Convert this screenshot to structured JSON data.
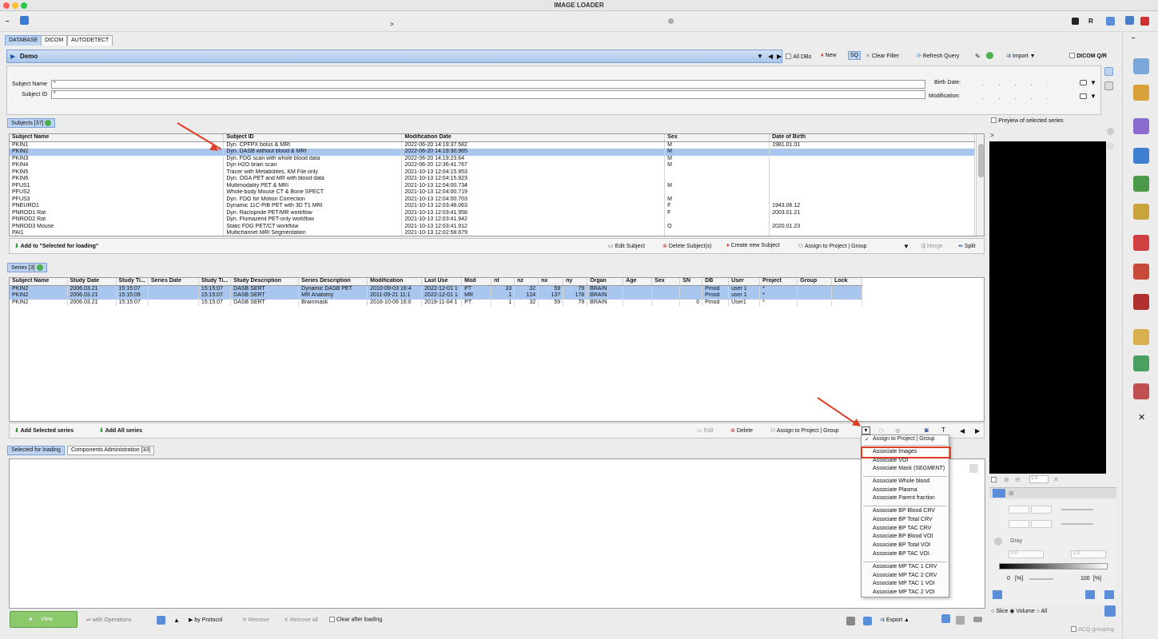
{
  "window": {
    "title": "IMAGE LOADER"
  },
  "toolbar": {
    "chevron": ">",
    "r": "R"
  },
  "tabs": [
    "DATABASE",
    "DICOM",
    "AUTODETECT"
  ],
  "db": {
    "name": "Demo",
    "all_dbs": "All DBs",
    "new": "New",
    "sq": "SQ",
    "clear_filter": "Clear Filter",
    "refresh": "Refresh Query",
    "import": "Import",
    "dicom_qr": "DICOM Q/R"
  },
  "filter": {
    "subject_name_label": "Subject Name",
    "subject_name_value": "*",
    "subject_id_label": "Subject ID",
    "subject_id_value": "*",
    "birth_label": "Birth Date:",
    "mod_label": "Modification:"
  },
  "subjects": {
    "tab": "Subjects [37]",
    "columns": [
      "Subject Name",
      "Subject ID",
      "Modification Date",
      "Sex",
      "Date of Birth"
    ],
    "rows": [
      [
        "PKIN1",
        "Dyn. CPFPX bolus & MRI",
        "2022-06-20 14:19:37.582",
        "M",
        "1981.01.01"
      ],
      [
        "PKIN2",
        "Dyn. DASB without blood & MRI",
        "2022-06-20 14:19:30.965",
        "M",
        ""
      ],
      [
        "PKIN3",
        "Dyn. FDG scan with whole blood data",
        "2022-06-20 14:19:23.64",
        "M",
        ""
      ],
      [
        "PKIN4",
        "Dyn H2O brain scan",
        "2022-06-20 12:36:41.767",
        "M",
        ""
      ],
      [
        "PKIN5",
        "Tracer with Metabolites, KM File only",
        "2021-10-13 12:04:15.953",
        "",
        ""
      ],
      [
        "PKIN6",
        "Dyn. OGA PET and MR with blood data",
        "2021-10-13 12:04:15.923",
        "",
        ""
      ],
      [
        "PFUS1",
        "Multimodality PET & MRI",
        "2021-10-13 12:04:00.734",
        "M",
        ""
      ],
      [
        "PFUS2",
        "Whole-body Mouse CT & Bone SPECT",
        "2021-10-13 12:04:00.719",
        "",
        ""
      ],
      [
        "PFUS3",
        "Dyn. FDG for Motion Correction",
        "2021-10-13 12:04:00.703",
        "M",
        ""
      ],
      [
        "PNEURO1",
        "Dynamic 11C-PiB PET with 3D T1 MRI",
        "2021-10-13 12:03:48.063",
        "F",
        "1943.06.12"
      ],
      [
        "PNROD1 Rat",
        "Dyn. Raclopride PET/MR workflow",
        "2021-10-13 12:03:41.958",
        "F",
        "2003.01.21"
      ],
      [
        "PNROD2 Rat",
        "Dyn. Flumazenil PET-only workflow",
        "2021-10-13 12:03:41.942",
        "",
        ""
      ],
      [
        "PNROD3 Mouse",
        "Static FDG PET/CT workflow",
        "2021-10-13 12:03:41.912",
        "O",
        "2020.01.23"
      ],
      [
        "PAI1",
        "Multichannel MRI Segmentation",
        "2021-10-13 12:02:58.679",
        "",
        ""
      ]
    ],
    "add_btn": "Add to \"Selected for loading\"",
    "edit": "Edit Subject",
    "delete": "Delete Subject(s)",
    "create": "Create new Subject",
    "assign": "Assign to Project | Group",
    "merge": "Merge",
    "split": "Split"
  },
  "series": {
    "tab": "Series [3]",
    "columns": [
      "Subject Name",
      "Study Date",
      "Study Ti...",
      "Series Date",
      "Study Ti...",
      "Study Description",
      "Series Description",
      "Modification",
      "Last Use",
      "Mod",
      "nt",
      "nz",
      "nx",
      "ny",
      "Organ",
      "Age",
      "Sex",
      "SN",
      "DB",
      "User",
      "Project",
      "Group",
      "Lock"
    ],
    "rows": [
      [
        "PKIN2",
        "2006.03.21",
        "15:15:07",
        "",
        "15:15:07",
        "DASB SERT",
        "Dynamic DASB PET",
        "2010-09-03 16:4",
        "2022-12-01 1",
        "PT",
        "33",
        "32",
        "59",
        "79",
        "BRAIN",
        "",
        "",
        "",
        "Pmod",
        "user 1",
        "*",
        "",
        ""
      ],
      [
        "PKIN2",
        "2006.03.21",
        "15:15:09",
        "",
        "15:15:07",
        "DASB SERT",
        "MR Anatomy",
        "2011-09-21 11:1",
        "2022-12-01 1",
        "MR",
        "1",
        "124",
        "137",
        "178",
        "BRAIN",
        "",
        "",
        "",
        "Pmod",
        "user 1",
        "*",
        "",
        ""
      ],
      [
        "PKIN2",
        "2006.03.21",
        "15:15:07",
        "",
        "15:15:07",
        "DASB SERT",
        "Brainmask",
        "2016-10-06 16:0",
        "2019-11-04 1",
        "PT",
        "1",
        "32",
        "59",
        "79",
        "BRAIN",
        "",
        "",
        "0",
        "Pmod",
        "User1",
        "*",
        "",
        ""
      ]
    ],
    "add_selected": "Add Selected series",
    "add_all": "Add All series",
    "edit": "Edit",
    "delete": "Delete",
    "assign": "Assign to Project | Group"
  },
  "menu": {
    "items": [
      "Assign to Project | Group",
      "Associate Images",
      "Associate VOI",
      "Associate Mask (SEGMENT)",
      "Associate Whole blood",
      "Associate Plasma",
      "Associate Parent fraction",
      "Associate BP Blood CRV",
      "Associate BP Total CRV",
      "Associate BP TAC CRV",
      "Associate BP Blood VOI",
      "Associate BP Total VOI",
      "Associate BP TAC VOI",
      "Associate MP TAC 1 CRV",
      "Associate MP TAC 2 CRV",
      "Associate MP TAC 1 VOI",
      "Associate MP TAC 2 VOI"
    ],
    "check": "✓"
  },
  "loading": {
    "tab1": "Selected for loading",
    "tab2": "Components Administration [33]"
  },
  "bottom": {
    "view": "View",
    "with_ops": "with Operations",
    "by_protocol": "by Protocol",
    "remove": "Remove",
    "remove_all": "Remove all",
    "clear_after": "Clear after loading",
    "export": "Export"
  },
  "preview": {
    "label": "Preyiew of selected series",
    "lut": "Gray",
    "min": "0.0",
    "max": "1.0",
    "zoom": "1.0",
    "pct0": "0",
    "pct_unit": "[%]",
    "pct100": "100",
    "slice": "Slice",
    "volume": "Volume",
    "all": "All",
    "acq": "ACQ grouping",
    "gt": ">"
  }
}
